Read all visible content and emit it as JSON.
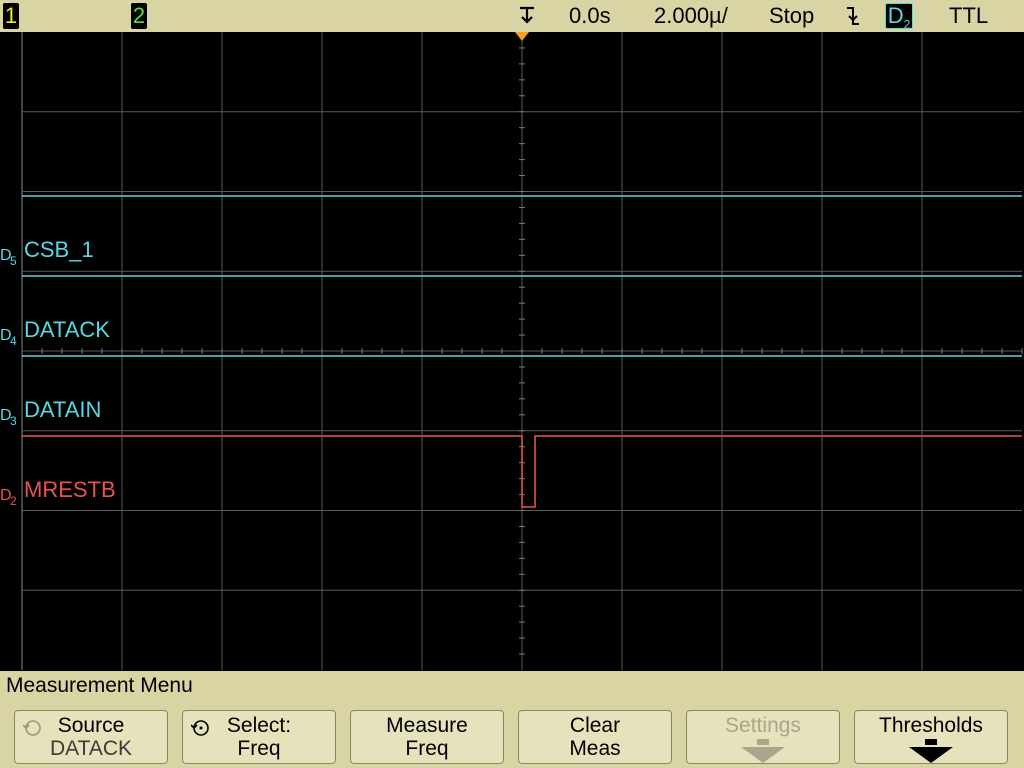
{
  "status_bar": {
    "channel1": "1",
    "channel2": "2",
    "time_position": "0.0s",
    "timebase": "2.000µ/",
    "run_state": "Stop",
    "trigger_source": "D",
    "trigger_source_sub": "2",
    "trigger_level": "TTL",
    "trigger_edge_icon": "falling-edge-icon",
    "trigger_marker_icon": "trigger-position-icon"
  },
  "channels": [
    {
      "label": "D",
      "sub": "5",
      "name": "CSB_1",
      "color": "#58d8e2",
      "state": "high"
    },
    {
      "label": "D",
      "sub": "4",
      "name": "DATACK",
      "color": "#58d8e2",
      "state": "high"
    },
    {
      "label": "D",
      "sub": "3",
      "name": "DATAIN",
      "color": "#58d8e2",
      "state": "high"
    },
    {
      "label": "D",
      "sub": "2",
      "name": "MRESTB",
      "color": "#e8534c",
      "state": "pulse-low"
    }
  ],
  "colors": {
    "background": "#000000",
    "grid": "#5a5a5a",
    "digital": "#58d8e2",
    "selected_digital": "#e8534c",
    "menu_bg": "#d9d4a3",
    "trigger_marker": "#f0a020"
  },
  "menu": {
    "title": "Measurement Menu",
    "softkeys": [
      {
        "line1": "Source",
        "line2": "DATACK",
        "icon": "rotary-knob-icon",
        "enabled": true
      },
      {
        "line1": "Select:",
        "line2": "Freq",
        "icon": "rotary-knob-icon",
        "enabled": true
      },
      {
        "line1": "Measure",
        "line2": "Freq",
        "enabled": true
      },
      {
        "line1": "Clear",
        "line2": "Meas",
        "enabled": true
      },
      {
        "line1": "Settings",
        "icon": "submenu-arrow-icon",
        "enabled": false
      },
      {
        "line1": "Thresholds",
        "icon": "submenu-arrow-icon",
        "enabled": true
      }
    ]
  }
}
